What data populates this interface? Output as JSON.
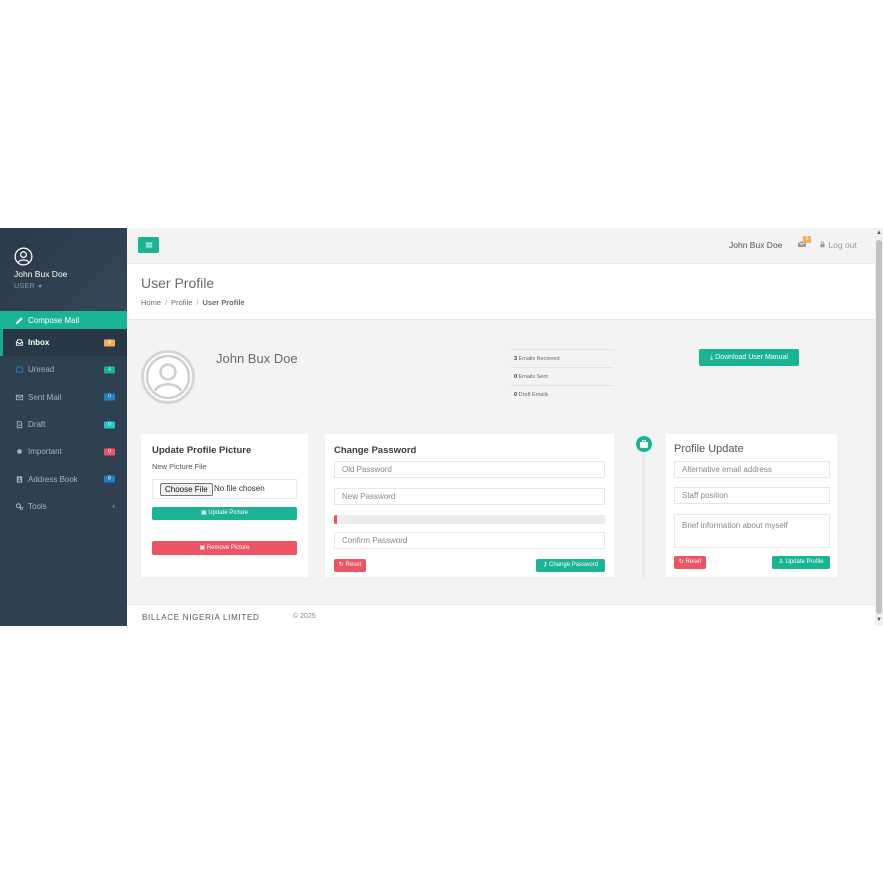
{
  "sidebar": {
    "username": "John Bux Doe",
    "role": "USER",
    "compose": "Compose Mail",
    "items": [
      {
        "label": "Inbox",
        "badge": "3",
        "icon": "inbox-icon",
        "badge_color": "#f8ac59"
      },
      {
        "label": "Unread",
        "badge": "3",
        "icon": "unread-icon",
        "badge_color": "#1ab394"
      },
      {
        "label": "Sent Mail",
        "badge": "0",
        "icon": "envelope-icon",
        "badge_color": "#1c84c6"
      },
      {
        "label": "Draft",
        "badge": "0",
        "icon": "file-icon",
        "badge_color": "#23c6c8"
      },
      {
        "label": "Important",
        "badge": "0",
        "icon": "dot-icon",
        "badge_color": "#ed5565"
      },
      {
        "label": "Address Book",
        "badge": "8",
        "icon": "address-book-icon",
        "badge_color": "#1c84c6"
      },
      {
        "label": "Tools",
        "badge": "",
        "icon": "cogs-icon",
        "badge_color": ""
      }
    ]
  },
  "topbar": {
    "username": "John Bux Doe",
    "mail_count": "3",
    "logout": "Log out"
  },
  "header": {
    "title": "User Profile",
    "breadcrumb": [
      "Home",
      "Profile",
      "User Profile"
    ]
  },
  "profile": {
    "name": "John Bux Doe",
    "stats": [
      {
        "value": "3",
        "label": "Emails Recieved"
      },
      {
        "value": "0",
        "label": "Emails Sent"
      },
      {
        "value": "0",
        "label": "Draft Emails"
      }
    ],
    "download_button": "Download User Manual"
  },
  "picture_card": {
    "title": "Update Profile Picture",
    "file_label": "New Picture File",
    "file_button": "Choose File",
    "file_status": "No file chosen",
    "update_button": "Update Picture",
    "remove_button": "Remove Picture"
  },
  "password_card": {
    "title": "Change Password",
    "old_placeholder": "Old Password",
    "new_placeholder": "New Password",
    "confirm_placeholder": "Confirm Password",
    "strength": 0.01,
    "reset_button": "Reset",
    "submit_button": "Change Password"
  },
  "update_card": {
    "title": "Profile Update",
    "alt_email_placeholder": "Alternative email address",
    "position_placeholder": "Staff position",
    "bio_placeholder": "Brief information about myself",
    "reset_button": "Reset",
    "submit_button": "Update Profile"
  },
  "footer": {
    "company": "BILLACE NIGERIA LIMITED",
    "copyright": "© 2025"
  },
  "colors": {
    "accent": "#1ab394",
    "danger": "#ed5565",
    "sidebar": "#2f4050"
  }
}
